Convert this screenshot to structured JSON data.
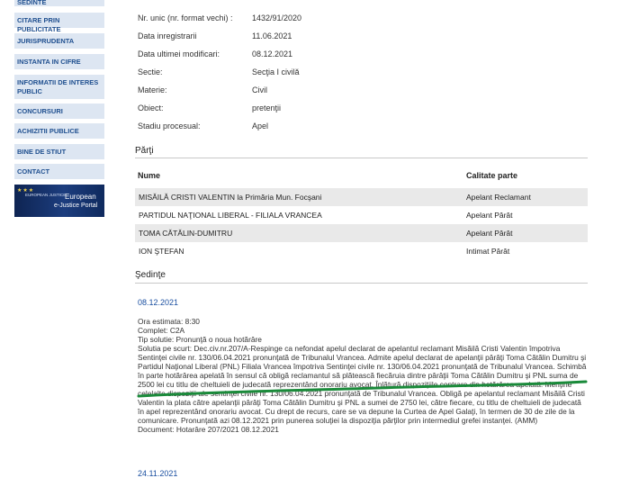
{
  "sidebar": {
    "items": [
      {
        "label": "SEDINTE"
      },
      {
        "label": "CITARE PRIN PUBLICITATE"
      },
      {
        "label": "JURISPRUDENTA"
      },
      {
        "label": "INSTANTA IN CIFRE"
      },
      {
        "label": "INFORMATII DE INTERES PUBLIC"
      },
      {
        "label": "CONCURSURI"
      },
      {
        "label": "ACHIZITII PUBLICE"
      },
      {
        "label": "BINE DE STIUT"
      },
      {
        "label": "CONTACT"
      }
    ],
    "banner": {
      "small_text": "EUROPEAN JUSTICE",
      "line1": "European",
      "line2": "e-Justice Portal",
      "icon": "eu-stars-icon"
    }
  },
  "case_info": {
    "rows": [
      {
        "label": "Nr. unic (nr. format vechi) :",
        "value": "1432/91/2020"
      },
      {
        "label": "Data inregistrarii",
        "value": "11.06.2021"
      },
      {
        "label": "Data ultimei modificari:",
        "value": "08.12.2021"
      },
      {
        "label": "Sectie:",
        "value": "Secţia I civilă"
      },
      {
        "label": "Materie:",
        "value": "Civil"
      },
      {
        "label": "Obiect:",
        "value": "pretenţii"
      },
      {
        "label": "Stadiu procesual:",
        "value": "Apel"
      }
    ]
  },
  "parties": {
    "title": "Părţi",
    "headers": {
      "name": "Nume",
      "role": "Calitate parte"
    },
    "rows": [
      {
        "name": "MISĂILĂ CRISTI VALENTIN la Primăria Mun. Focşani",
        "role": "Apelant Reclamant"
      },
      {
        "name": "PARTIDUL NAŢIONAL LIBERAL - FILIALA VRANCEA",
        "role": "Apelant Pârât"
      },
      {
        "name": "TOMA CĂTĂLIN-DUMITRU",
        "role": "Apelant Pârât"
      },
      {
        "name": "ION ŞTEFAN",
        "role": "Intimat Pârât"
      }
    ]
  },
  "hearings": {
    "title": "Şedinţe",
    "items": [
      {
        "date": "08.12.2021",
        "time": "Ora estimata: 8:30",
        "panel": "Complet: C2A",
        "type": "Tip solutie: Pronunţă o noua hotărâre",
        "summary": "Solutia pe scurt: Dec.civ.nr.207/A-Respinge ca nefondat apelul declarat de apelantul reclamant Misăilă Cristi Valentin împotriva Sentinţei civile nr. 130/06.04.2021 pronunţată de Tribunalul Vrancea. Admite apelul declarat de apelanţii pârâţi Toma Cătălin Dumitru şi Partidul Naţional Liberal (PNL) Filiala Vrancea împotriva Sentinţei civile nr. 130/06.04.2021 pronunţată de Tribunalul Vrancea. Schimbă în parte hotărârea apelată în sensul că obligă reclamantul să plătească fiecăruia dintre pârâţii Toma Cătălin Dumitru şi PNL suma de 2500 lei cu titlu de cheltuieli de judecată reprezentând onorariu avocat. Înlătură dispoziţiile contrare din hotărârea apelată. Menţine celelalte dispoziţii ale sentinţei civile nr. 130/06.04.2021 pronunţată de Tribunalul Vrancea. Obligă pe apelantul reclamant Misăilă Cristi Valentin la plata către apelanţii pârâţi Toma Cătălin Dumitru şi PNL a sumei de 2750 lei, către fiecare, cu titlu de cheltuieli de judecată în apel reprezentând onorariu avocat. Cu drept de recurs, care se va depune la Curtea de Apel Galaţi, în termen de 30 de zile de la comunicare. Pronunţată azi 08.12.2021 prin punerea soluţiei la dispoziţia părţilor prin intermediul grefei instanţei. (AMM)",
        "document": "Document: Hotarâre  207/2021  08.12.2021"
      },
      {
        "date": "24.11.2021"
      }
    ]
  },
  "colors": {
    "nav_bg": "#dde6f2",
    "nav_text": "#1f4f8f",
    "link": "#1a4fa0",
    "row_alt": "#e9e9e9",
    "highlight": "#1a8a3a"
  }
}
